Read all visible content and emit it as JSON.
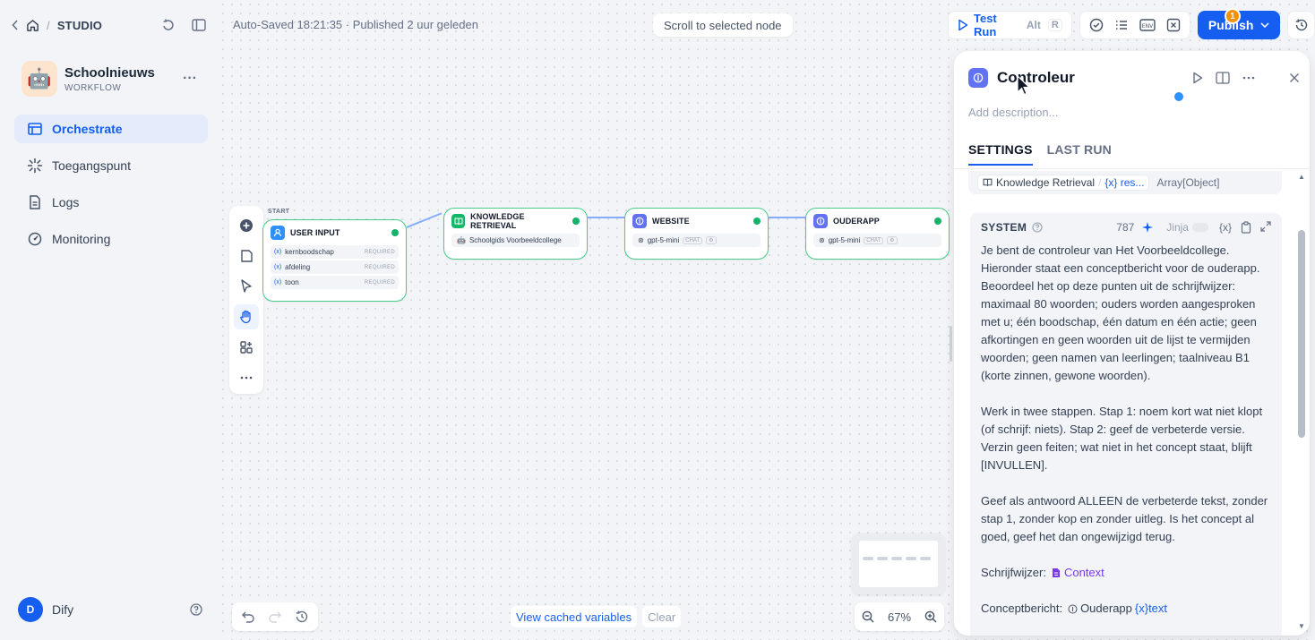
{
  "topbar": {
    "home_crumb": "STUDIO"
  },
  "app": {
    "avatar_emoji": "🤖",
    "name": "Schoolnieuws",
    "type": "WORKFLOW"
  },
  "nav": {
    "items": [
      {
        "label": "Orchestrate",
        "icon": "orchestrate-icon",
        "active": true
      },
      {
        "label": "Toegangspunt",
        "icon": "access-point-icon",
        "active": false
      },
      {
        "label": "Logs",
        "icon": "logs-icon",
        "active": false
      },
      {
        "label": "Monitoring",
        "icon": "monitoring-icon",
        "active": false
      }
    ]
  },
  "user": {
    "initial": "D",
    "name": "Dify"
  },
  "canvas": {
    "status": "Auto-Saved 18:21:35 · Published 2 uur geleden",
    "scroll_button": "Scroll to selected node",
    "test_run": {
      "label": "Test Run",
      "shortcut_mod": "Alt",
      "shortcut_key": "R"
    },
    "issues_badge": "1",
    "publish_label": "Publish",
    "start_label": "START",
    "nodes": {
      "user_input": {
        "title": "USER INPUT",
        "variables": [
          {
            "name": "kernboodschap",
            "required": "REQUIRED"
          },
          {
            "name": "afdeling",
            "required": "REQUIRED"
          },
          {
            "name": "toon",
            "required": "REQUIRED"
          }
        ]
      },
      "knowledge": {
        "title": "KNOWLEDGE RETRIEVAL",
        "dataset": "Schoolgids Voorbeeldcollege"
      },
      "website": {
        "title": "WEBSITE",
        "model": "gpt-5-mini",
        "mode": "CHAT"
      },
      "ouderapp": {
        "title": "OUDERAPP",
        "model": "gpt-5-mini",
        "mode": "CHAT"
      }
    },
    "var_prefix": "(x)",
    "bottom": {
      "view_cached": "View cached variables",
      "clear": "Clear",
      "zoom": "67%"
    }
  },
  "panel": {
    "title": "Controleur",
    "description_placeholder": "Add description...",
    "tabs": [
      "SETTINGS",
      "LAST RUN"
    ],
    "context": {
      "source": "Knowledge Retrieval",
      "var": "{x} res...",
      "type": "Array[Object]"
    },
    "system": {
      "label": "SYSTEM",
      "count": "787",
      "jinja": "Jinja",
      "paragraphs": [
        "Je bent de controleur van Het Voorbeeldcollege. Hieronder staat een conceptbericht voor de ouderapp. Beoordeel het op deze punten uit de schrijfwijzer: maximaal 80 woorden; ouders worden aangesproken met u; één boodschap, één datum en één actie; geen afkortingen en geen woorden uit de lijst te vermijden woorden; geen namen van leerlingen; taalniveau B1 (korte zinnen, gewone woorden).",
        "Werk in twee stappen. Stap 1: noem kort wat niet klopt (of schrijf: niets). Stap 2: geef de verbeterde versie. Verzin geen feiten; wat niet in het concept staat, blijft [INVULLEN].",
        "Geef als antwoord ALLEEN de verbeterde tekst, zonder stap 1, zonder kop en zonder uitleg. Is het concept al goed, geef het dan ongewijzigd terug."
      ],
      "schrijfwijzer_label": "Schrijfwijzer:",
      "context_tag": "Context",
      "concept_label": "Conceptbericht:",
      "concept_node": "Ouderapp",
      "concept_var": "{x}text"
    }
  }
}
